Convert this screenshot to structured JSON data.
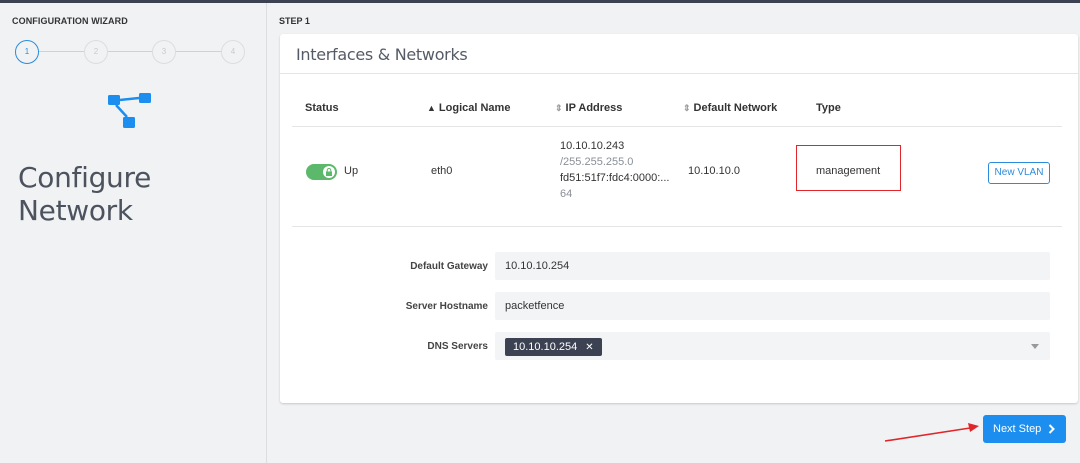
{
  "sidebar": {
    "title": "CONFIGURATION WIZARD",
    "steps": [
      "1",
      "2",
      "3",
      "4"
    ],
    "heading": "Configure Network",
    "icon": "network-icon"
  },
  "main": {
    "step_label": "STEP 1",
    "card_title": "Interfaces & Networks",
    "table": {
      "headers": {
        "status": "Status",
        "logical_name": "Logical Name",
        "ip_address": "IP Address",
        "default_network": "Default Network",
        "type": "Type"
      },
      "rows": [
        {
          "status": "Up",
          "logical_name": "eth0",
          "ip_v4": "10.10.10.243",
          "netmask": "/255.255.255.0",
          "ip_v6": "fd51:51f7:fdc4:0000:...",
          "prefix": "64",
          "default_network": "10.10.10.0",
          "type": "management",
          "action": "New VLAN"
        }
      ]
    },
    "form": {
      "gateway_label": "Default Gateway",
      "gateway_value": "10.10.10.254",
      "hostname_label": "Server Hostname",
      "hostname_value": "packetfence",
      "dns_label": "DNS Servers",
      "dns_tags": [
        "10.10.10.254"
      ]
    },
    "next_button": "Next Step"
  },
  "colors": {
    "accent": "#1b8ef0",
    "toggle_on": "#5cb86a",
    "highlight": "#e0262a",
    "tag_bg": "#3c4251"
  }
}
